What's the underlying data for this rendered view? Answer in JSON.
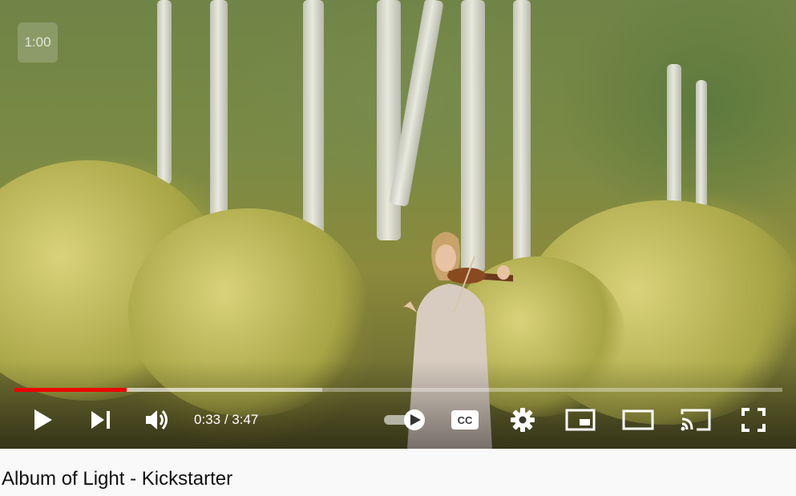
{
  "player": {
    "corner_badge": "1:00",
    "progress": {
      "played_fraction": 0.146,
      "buffered_fraction": 0.401
    },
    "time": {
      "current": "0:33",
      "separator": " / ",
      "duration": "3:47"
    },
    "autoplay_on": true,
    "colors": {
      "played": "#ee0000",
      "controls": "#ffffff"
    },
    "icons": {
      "play": "play-icon",
      "next": "next-icon",
      "volume": "volume-icon",
      "autoplay": "autoplay-toggle-icon",
      "captions": "cc-icon",
      "settings": "gear-icon",
      "miniplayer": "miniplayer-icon",
      "theater": "theater-mode-icon",
      "cast": "cast-icon",
      "fullscreen": "fullscreen-icon"
    }
  },
  "video": {
    "title": "Album of Light - Kickstarter"
  }
}
